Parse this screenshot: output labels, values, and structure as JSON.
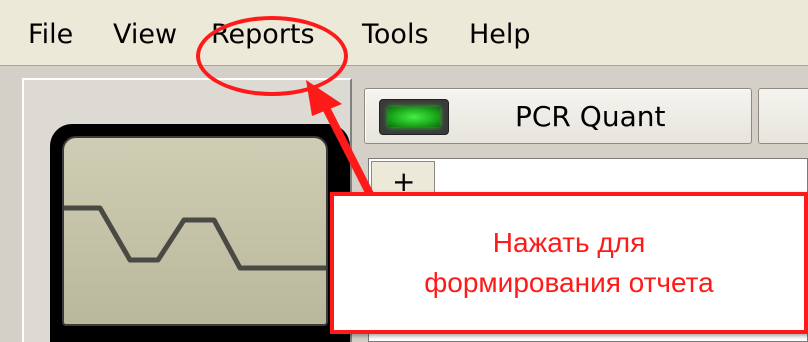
{
  "menu": {
    "file": "File",
    "view": "View",
    "reports": "Reports",
    "tools": "Tools",
    "help": "Help"
  },
  "toolbar": {
    "pcr_quant_label": "PCR Quant",
    "status_led_color": "#22cc22"
  },
  "grid": {
    "expand_label": "+"
  },
  "annotation": {
    "color": "#ff1a1a",
    "lines": [
      "Нажать для",
      "формирования отчета"
    ]
  },
  "icons": {
    "device_screen": "waveform-icon",
    "status_led": "led-icon",
    "expand": "plus-icon",
    "pointer": "arrow-icon"
  }
}
